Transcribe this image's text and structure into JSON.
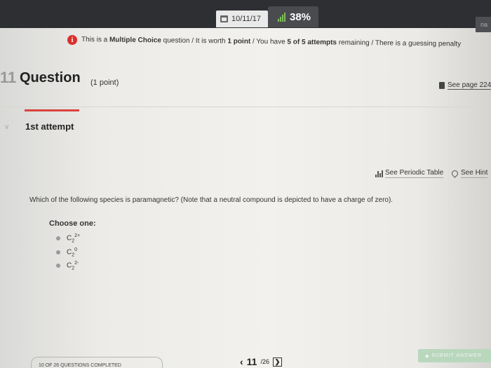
{
  "header": {
    "date": "10/11/17",
    "progress_label": "38%",
    "progress": 0.38,
    "corner_text": "na"
  },
  "info": {
    "text_1": "This is a ",
    "bold_1": "Multiple Choice",
    "text_2": " question / It is worth ",
    "bold_2": "1 point",
    "text_3": " / You have ",
    "bold_3": "5 of 5 attempts",
    "text_4": " remaining / There is a guessing penalty"
  },
  "question": {
    "number": "11",
    "title": "Question",
    "points": "(1 point)",
    "see_page": "See page 224",
    "attempt": "1st attempt",
    "periodic_table": "See Periodic Table",
    "hint": "See Hint",
    "prompt": "Which of the following species is paramagnetic? (Note that a neutral compound is depicted to have a charge of zero).",
    "choose_label": "Choose one:",
    "options": [
      {
        "base": "C",
        "sub": "2",
        "sup": "2+"
      },
      {
        "base": "C",
        "sub": "2",
        "sup": "0"
      },
      {
        "base": "C",
        "sub": "2",
        "sup": "2-"
      }
    ]
  },
  "footer": {
    "completed": "10 OF 26 QUESTIONS COMPLETED",
    "current": "11",
    "total": "/26",
    "submit": "SUBMIT ANSWER"
  },
  "colors": {
    "accent_red": "#d9433e",
    "progress_green": "#7fbf5b",
    "submit_bg": "#b9d7bd",
    "topbar": "#2e2f33"
  },
  "icons": {
    "date": "calendar-icon",
    "progress": "bar-chart-icon",
    "info": "info-icon",
    "page": "book-icon",
    "periodic": "periodic-table-icon",
    "hint": "hint-pin-icon",
    "collapse": "chevron-down-icon",
    "prev": "chevron-left-icon",
    "next": "chevron-right-icon",
    "submit": "submit-icon"
  }
}
